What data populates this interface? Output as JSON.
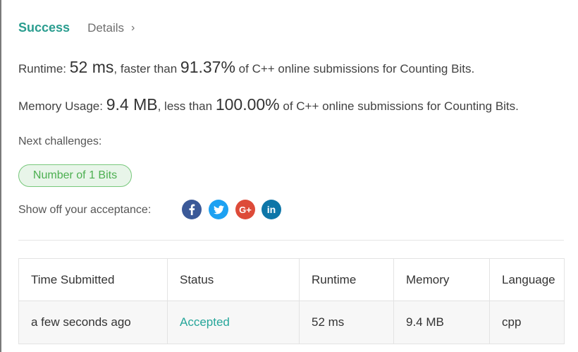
{
  "header": {
    "status_label": "Success",
    "details_label": "Details",
    "details_chevron": "›"
  },
  "runtime": {
    "label": "Runtime:",
    "value": "52 ms",
    "comparison_text": ", faster than",
    "percentile": "91.37%",
    "suffix": "of C++ online submissions for Counting Bits."
  },
  "memory": {
    "label": "Memory Usage:",
    "value": "9.4 MB",
    "comparison_text": ", less than",
    "percentile": "100.00%",
    "suffix": "of C++ online submissions for Counting Bits."
  },
  "next_challenges": {
    "label": "Next challenges:",
    "items": [
      "Number of 1 Bits"
    ]
  },
  "share": {
    "label": "Show off your acceptance:",
    "icons": [
      {
        "name": "facebook-icon",
        "glyph": "f",
        "color": "#3b5998"
      },
      {
        "name": "twitter-icon",
        "glyph": "t",
        "color": "#1da1f2"
      },
      {
        "name": "google-plus-icon",
        "glyph": "G+",
        "color": "#dd4b39"
      },
      {
        "name": "linkedin-icon",
        "glyph": "in",
        "color": "#0e76a8"
      }
    ]
  },
  "table": {
    "headers": [
      "Time Submitted",
      "Status",
      "Runtime",
      "Memory",
      "Language"
    ],
    "rows": [
      [
        "a few seconds ago",
        "Accepted",
        "52 ms",
        "9.4 MB",
        "cpp"
      ]
    ]
  },
  "colors": {
    "success": "#2a9d8f",
    "accepted": "#26a69a",
    "pill_border": "#78c87c",
    "pill_bg": "#e8f5e9"
  }
}
